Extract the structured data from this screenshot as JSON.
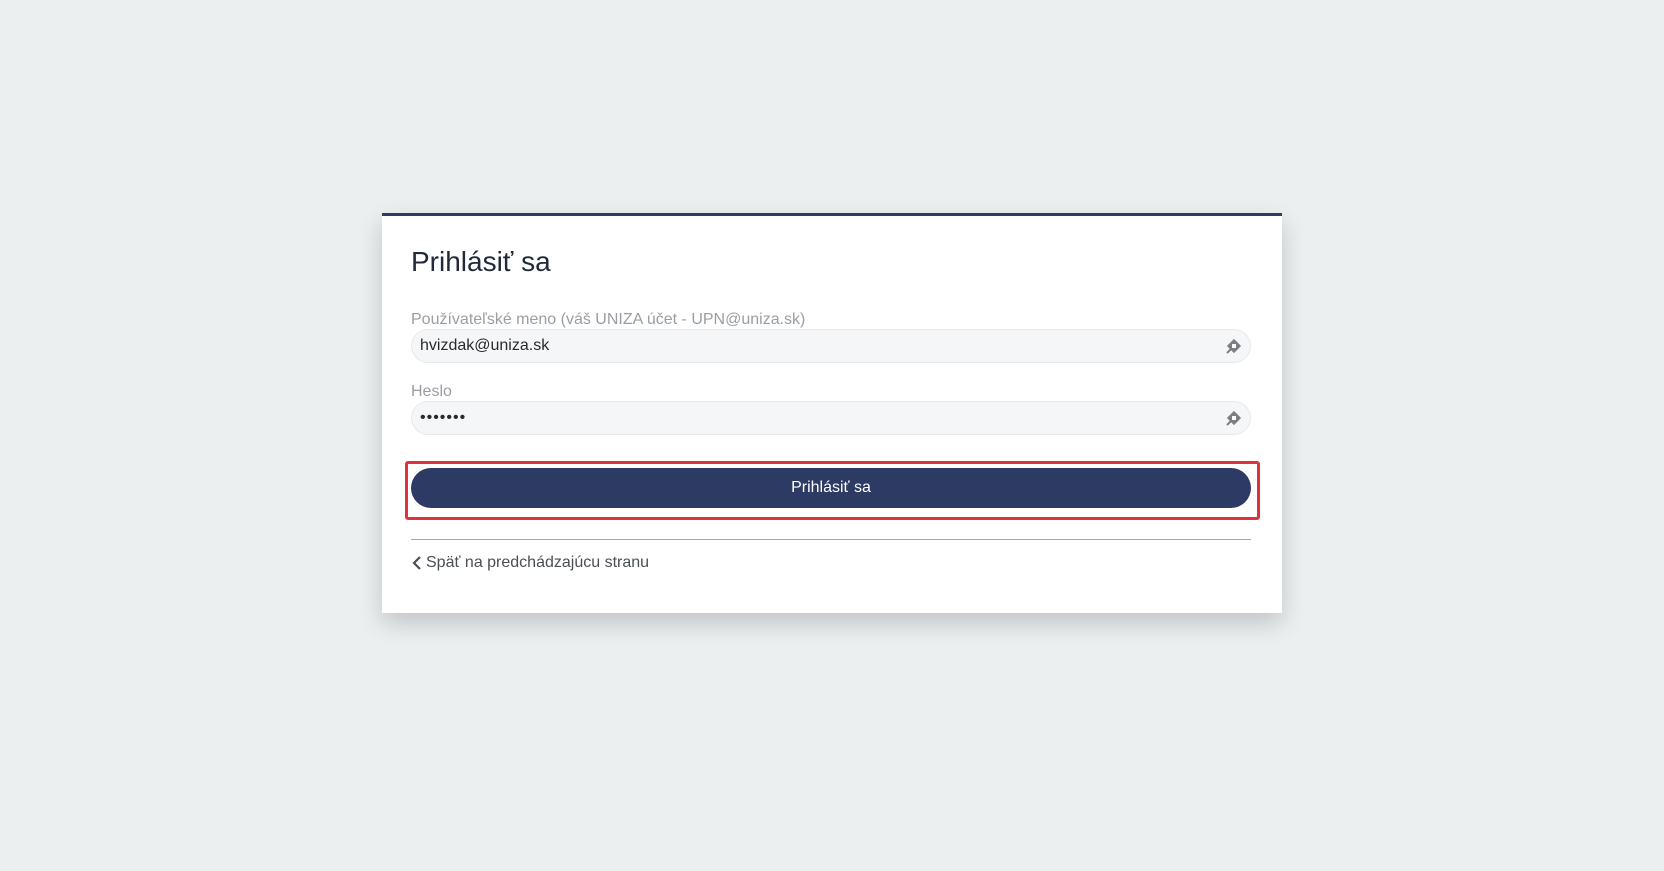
{
  "login": {
    "title": "Prihlásiť sa",
    "username": {
      "label": "Používateľské meno (váš UNIZA účet - UPN@uniza.sk)",
      "value": "hvizdak@uniza.sk"
    },
    "password": {
      "label": "Heslo",
      "value": "•••••••"
    },
    "submit_label": "Prihlásiť sa",
    "back_link": "Späť na predchádzajúcu stranu"
  },
  "colors": {
    "accent": "#2c3a64",
    "highlight": "#e0323c",
    "background": "#ebeff0"
  },
  "icons": {
    "field": "password-manager-icon",
    "back": "chevron-left-icon"
  }
}
